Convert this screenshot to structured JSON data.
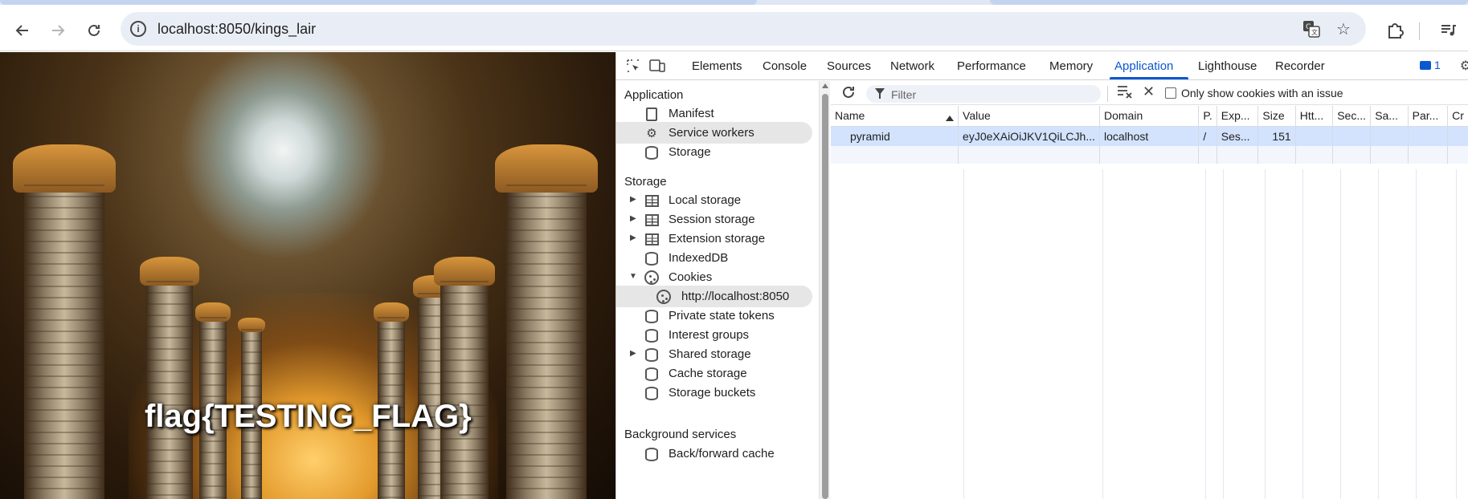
{
  "browser": {
    "url": "localhost:8050/kings_lair",
    "back_icon": "arrow-left",
    "forward_icon": "arrow-right",
    "reload_icon": "reload",
    "info_icon": "info-circle",
    "translate_icon": "translate",
    "bookmark_icon": "star",
    "extensions_icon": "puzzle-piece",
    "media_icon": "queue-music"
  },
  "page": {
    "flag_text": "flag{TESTING_FLAG}",
    "background_description_colors": [
      "#4b3418",
      "#e39a2c",
      "#cfd9d8"
    ]
  },
  "devtools": {
    "tabs": [
      "Elements",
      "Console",
      "Sources",
      "Network",
      "Performance",
      "Memory",
      "Application",
      "Lighthouse",
      "Recorder"
    ],
    "active_tab": "Application",
    "issues_count": "1",
    "accent_color": "#0b57d0",
    "sidebar": {
      "application_heading": "Application",
      "application_items": [
        {
          "label": "Manifest",
          "icon": "document-icon"
        },
        {
          "label": "Service workers",
          "icon": "gears-icon"
        },
        {
          "label": "Storage",
          "icon": "database-icon"
        }
      ],
      "storage_heading": "Storage",
      "storage_items": [
        {
          "label": "Local storage",
          "icon": "table-icon",
          "expandable": true
        },
        {
          "label": "Session storage",
          "icon": "table-icon",
          "expandable": true
        },
        {
          "label": "Extension storage",
          "icon": "table-icon",
          "expandable": true
        },
        {
          "label": "IndexedDB",
          "icon": "database-icon"
        },
        {
          "label": "Cookies",
          "icon": "cookie-icon",
          "expanded": true
        },
        {
          "label": "http://localhost:8050",
          "icon": "cookie-icon",
          "selected": true
        },
        {
          "label": "Private state tokens",
          "icon": "database-icon"
        },
        {
          "label": "Interest groups",
          "icon": "database-icon"
        },
        {
          "label": "Shared storage",
          "icon": "database-icon",
          "expandable": true
        },
        {
          "label": "Cache storage",
          "icon": "database-icon"
        },
        {
          "label": "Storage buckets",
          "icon": "database-icon"
        }
      ],
      "background_heading": "Background services",
      "background_items": [
        {
          "label": "Back/forward cache",
          "icon": "database-icon"
        }
      ]
    },
    "cookies": {
      "filter_placeholder": "Filter",
      "only_issues_label": "Only show cookies with an issue",
      "only_issues_checked": false,
      "columns": [
        "Name",
        "Value",
        "Domain",
        "P.",
        "Exp...",
        "Size",
        "Htt...",
        "Sec...",
        "Sa...",
        "Par...",
        "Cr"
      ],
      "sorted_column": "Name",
      "rows": [
        {
          "name": "pyramid",
          "value": "eyJ0eXAiOiJKV1QiLCJh...",
          "domain": "localhost",
          "path": "/",
          "expires": "Ses...",
          "size": "151",
          "httponly": "",
          "secure": "",
          "samesite": "",
          "partition": "",
          "cross": ""
        }
      ]
    }
  }
}
